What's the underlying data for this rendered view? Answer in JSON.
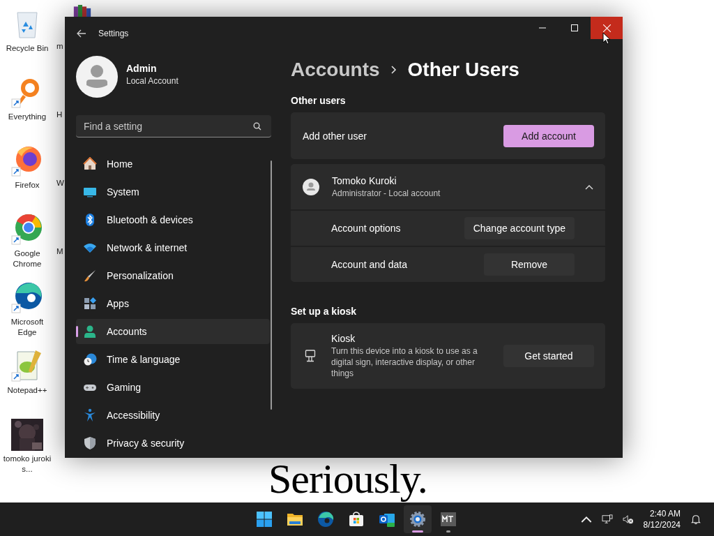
{
  "desktop": {
    "icons": [
      {
        "label": "Recycle Bin",
        "kind": "recycle"
      },
      {
        "label": "Everything",
        "kind": "everything"
      },
      {
        "label": "Firefox",
        "kind": "firefox"
      },
      {
        "label": "Google Chrome",
        "kind": "chrome"
      },
      {
        "label": "Microsoft Edge",
        "kind": "edge"
      },
      {
        "label": "Notepad++",
        "kind": "notepad"
      },
      {
        "label": "tomoko juroki s...",
        "kind": "picture"
      }
    ],
    "partial_labels": [
      "m",
      "H",
      "W",
      "M"
    ],
    "background_text": "Seriously."
  },
  "window": {
    "title": "Settings",
    "profile": {
      "name": "Admin",
      "account": "Local Account"
    },
    "search": {
      "placeholder": "Find a setting"
    },
    "nav": [
      {
        "label": "Home",
        "kind": "home",
        "selected": false
      },
      {
        "label": "System",
        "kind": "system",
        "selected": false
      },
      {
        "label": "Bluetooth & devices",
        "kind": "bluetooth",
        "selected": false
      },
      {
        "label": "Network & internet",
        "kind": "network",
        "selected": false
      },
      {
        "label": "Personalization",
        "kind": "personalization",
        "selected": false
      },
      {
        "label": "Apps",
        "kind": "apps",
        "selected": false
      },
      {
        "label": "Accounts",
        "kind": "accounts",
        "selected": true
      },
      {
        "label": "Time & language",
        "kind": "time",
        "selected": false
      },
      {
        "label": "Gaming",
        "kind": "gaming",
        "selected": false
      },
      {
        "label": "Accessibility",
        "kind": "accessibility",
        "selected": false
      },
      {
        "label": "Privacy & security",
        "kind": "privacy",
        "selected": false
      }
    ],
    "breadcrumb": {
      "parent": "Accounts",
      "current": "Other Users"
    },
    "other_users": {
      "heading": "Other users",
      "add_label": "Add other user",
      "add_button": "Add account",
      "user": {
        "name": "Tomoko Kuroki",
        "role": "Administrator - Local account",
        "expanded": true,
        "rows": [
          {
            "label": "Account options",
            "button": "Change account type"
          },
          {
            "label": "Account and data",
            "button": "Remove"
          }
        ]
      }
    },
    "kiosk": {
      "heading": "Set up a kiosk",
      "title": "Kiosk",
      "description": "Turn this device into a kiosk to use as a digital sign, interactive display, or other things",
      "button": "Get started"
    }
  },
  "taskbar": {
    "apps": [
      {
        "kind": "start",
        "selected": false,
        "running": false
      },
      {
        "kind": "files",
        "selected": false,
        "running": false
      },
      {
        "kind": "edge",
        "selected": false,
        "running": false
      },
      {
        "kind": "store",
        "selected": false,
        "running": false
      },
      {
        "kind": "outlook",
        "selected": false,
        "running": false
      },
      {
        "kind": "settings",
        "selected": true,
        "running": true
      },
      {
        "kind": "mt",
        "selected": false,
        "running": true
      }
    ],
    "time": "2:40 AM",
    "date": "8/12/2024"
  }
}
